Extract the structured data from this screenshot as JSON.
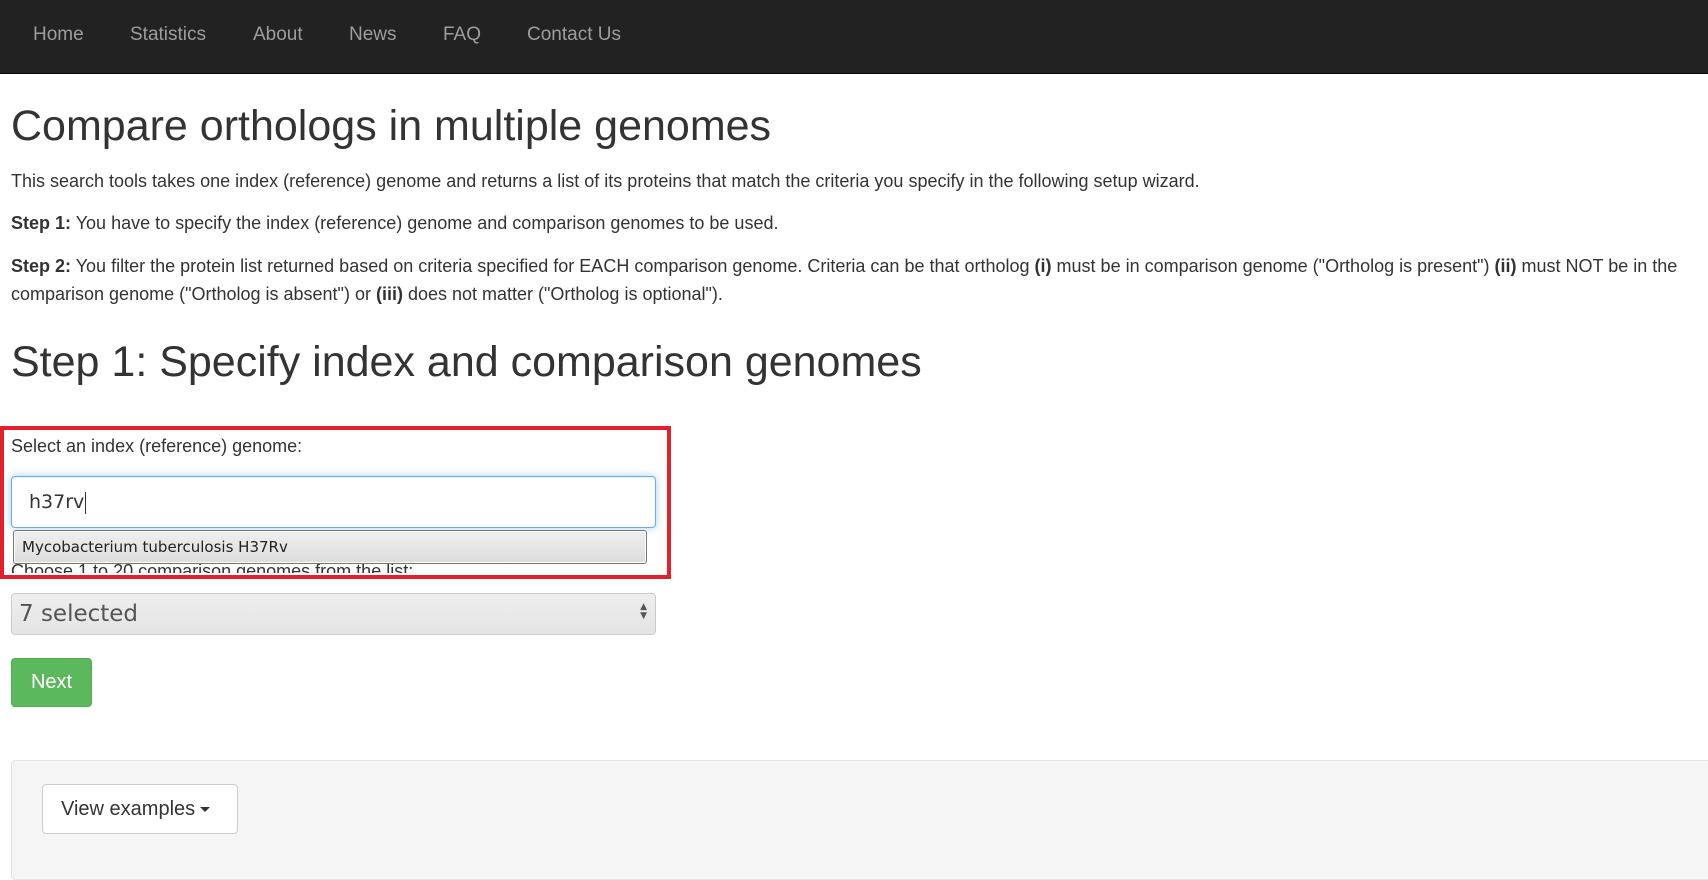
{
  "nav": {
    "items": [
      {
        "label": "Home"
      },
      {
        "label": "Statistics"
      },
      {
        "label": "About"
      },
      {
        "label": "News"
      },
      {
        "label": "FAQ"
      },
      {
        "label": "Contact Us"
      }
    ]
  },
  "intro": {
    "title": "Compare orthologs in multiple genomes",
    "description": "This search tools takes one index (reference) genome and returns a list of its proteins that match the criteria you specify in the following setup wizard.",
    "step1_label": "Step 1:",
    "step1_text": " You have to specify the index (reference) genome and comparison genomes to be used.",
    "step2_label": "Step 2:",
    "step2_text_a": " You filter the protein list returned based on criteria specified for EACH comparison genome. Criteria can be that ortholog ",
    "step2_i": "(i)",
    "step2_text_b": " must be in comparison genome (\"Ortholog is present\") ",
    "step2_ii": "(ii)",
    "step2_text_c": " must NOT be in the comparison genome (\"Ortholog is absent\") or ",
    "step2_iii": "(iii)",
    "step2_text_d": " does not matter (\"Ortholog is optional\")."
  },
  "step1": {
    "heading": "Step 1: Specify index and comparison genomes",
    "index_label": "Select an index (reference) genome:",
    "index_input_value": "h37rv",
    "autocomplete_option": "Mycobacterium tuberculosis H37Rv",
    "comparison_label": "Choose 1 to 20 comparison genomes from the list:",
    "comparison_selected": "7 selected",
    "next_label": "Next"
  },
  "examples": {
    "button_label": "View examples"
  },
  "colors": {
    "navbar_bg": "#222222",
    "nav_text": "#9d9d9d",
    "highlight": "#e3202b",
    "next_button": "#5cb85c"
  }
}
